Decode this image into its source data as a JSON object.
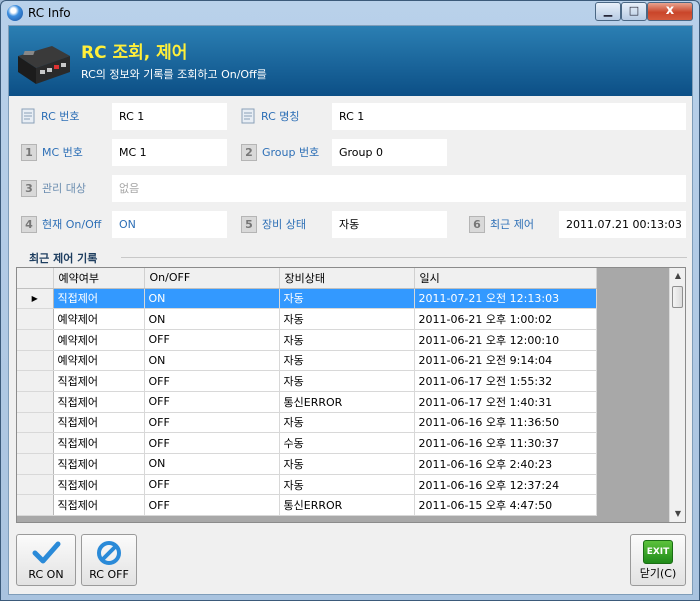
{
  "window": {
    "title": "RC Info",
    "close_glyph": "x",
    "min_glyph": "▁",
    "max_glyph": "□"
  },
  "header": {
    "title": "RC 조회, 제어",
    "subtitle": "RC의 정보와 기록를 조회하고 On/Off를"
  },
  "fields": {
    "rc_number": {
      "label": "RC 번호",
      "value": "RC 1"
    },
    "rc_name": {
      "label": "RC 명칭",
      "value": "RC 1"
    },
    "mc_number": {
      "num": "1",
      "label": "MC 번호",
      "value": "MC 1"
    },
    "group_number": {
      "num": "2",
      "label": "Group 번호",
      "value": "Group 0"
    },
    "managed_target": {
      "num": "3",
      "label": "관리 대상",
      "value": "없음"
    },
    "current_onoff": {
      "num": "4",
      "label": "현재 On/Off",
      "value": "ON"
    },
    "device_status": {
      "num": "5",
      "label": "장비 상태",
      "value": "자동"
    },
    "last_control": {
      "num": "6",
      "label": "최근 제어",
      "value": "2011.07.21 00:13:03"
    }
  },
  "history": {
    "title": "최근 제어 기록",
    "columns": [
      "예약여부",
      "On/OFF",
      "장비상태",
      "일시"
    ],
    "selected_marker": "▶",
    "rows": [
      [
        "직접제어",
        "ON",
        "자동",
        "2011-07-21 오전 12:13:03"
      ],
      [
        "예약제어",
        "ON",
        "자동",
        "2011-06-21 오후 1:00:02"
      ],
      [
        "예약제어",
        "OFF",
        "자동",
        "2011-06-21 오후 12:00:10"
      ],
      [
        "예약제어",
        "ON",
        "자동",
        "2011-06-21 오전 9:14:04"
      ],
      [
        "직접제어",
        "OFF",
        "자동",
        "2011-06-17 오전 1:55:32"
      ],
      [
        "직접제어",
        "OFF",
        "통신ERROR",
        "2011-06-17 오전 1:40:31"
      ],
      [
        "직접제어",
        "OFF",
        "자동",
        "2011-06-16 오후 11:36:50"
      ],
      [
        "직접제어",
        "OFF",
        "수동",
        "2011-06-16 오후 11:30:37"
      ],
      [
        "직접제어",
        "ON",
        "자동",
        "2011-06-16 오후 2:40:23"
      ],
      [
        "직접제어",
        "OFF",
        "자동",
        "2011-06-16 오후 12:37:24"
      ],
      [
        "직접제어",
        "OFF",
        "통신ERROR",
        "2011-06-15 오후 4:47:50"
      ]
    ]
  },
  "buttons": {
    "rc_on": "RC ON",
    "rc_off": "RC OFF",
    "exit_badge": "EXIT",
    "close": "닫기(C)"
  },
  "colors": {
    "accent_blue": "#2d6fb6",
    "banner_title": "#ffef3a",
    "selection": "#3399ff",
    "exit_green": "#1f8a19"
  }
}
